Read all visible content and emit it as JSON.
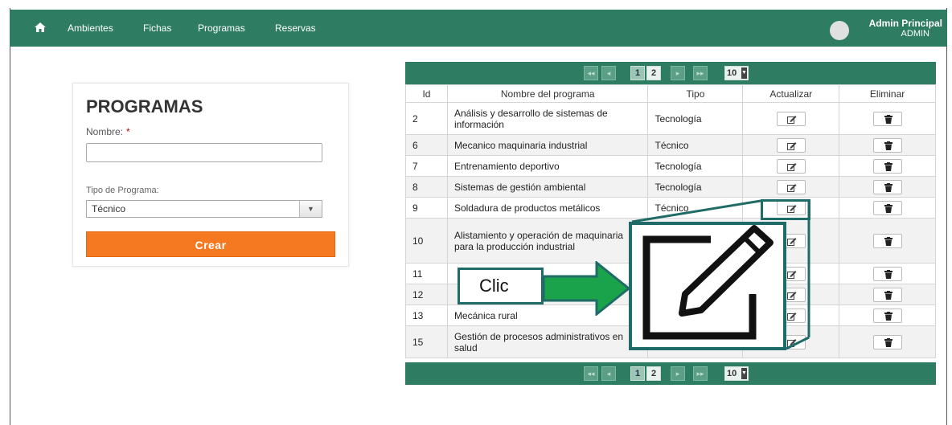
{
  "nav": {
    "items": [
      "Ambientes",
      "Fichas",
      "Programas",
      "Reservas"
    ],
    "user_name": "Admin Principal",
    "user_role": "ADMIN"
  },
  "form": {
    "title": "PROGRAMAS",
    "name_label": "Nombre:",
    "required_mark": "*",
    "name_value": "",
    "type_label": "Tipo de Programa:",
    "type_value": "Técnico",
    "create_label": "Crear"
  },
  "paginator": {
    "first": "◂◂",
    "prev": "◂",
    "pages": [
      "1",
      "2"
    ],
    "next": "▸",
    "last": "▸▸",
    "rows_per_page": "10"
  },
  "table": {
    "headers": [
      "Id",
      "Nombre del programa",
      "Tipo",
      "Actualizar",
      "Eliminar"
    ],
    "rows": [
      {
        "id": "2",
        "name": "Análisis y desarrollo de sistemas de información",
        "type": "Tecnología"
      },
      {
        "id": "6",
        "name": "Mecanico maquinaria industrial",
        "type": "Técnico"
      },
      {
        "id": "7",
        "name": "Entrenamiento deportivo",
        "type": "Tecnología"
      },
      {
        "id": "8",
        "name": "Sistemas de gestión ambiental",
        "type": "Tecnología"
      },
      {
        "id": "9",
        "name": "Soldadura de productos metálicos",
        "type": "Técnico"
      },
      {
        "id": "10",
        "name": "Alistamiento y operación de maquinaria para la producción industrial",
        "type": ""
      },
      {
        "id": "11",
        "name": "",
        "type": ""
      },
      {
        "id": "12",
        "name": "",
        "type": ""
      },
      {
        "id": "13",
        "name": "Mecánica rural",
        "type": ""
      },
      {
        "id": "15",
        "name": "Gestión de procesos administrativos en salud",
        "type": ""
      }
    ]
  },
  "callout": {
    "label": "Clic",
    "arrow_color": "#1aa34a",
    "border_color": "#1e6b67"
  },
  "colors": {
    "navbar": "#2e7d63",
    "create_button": "#f47920"
  }
}
